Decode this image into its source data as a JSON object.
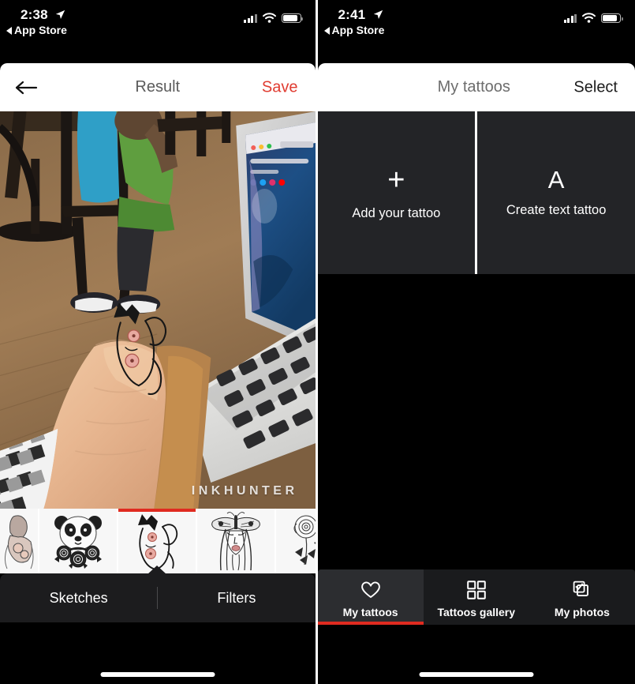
{
  "left_screen": {
    "status_bar": {
      "time": "2:38",
      "back_label": "App Store",
      "location_icon": "location-arrow-icon",
      "signal_icon": "cellular-signal-icon",
      "wifi_icon": "wifi-icon",
      "battery_icon": "battery-icon"
    },
    "nav": {
      "back_icon": "arrow-left-icon",
      "title": "Result",
      "action_label": "Save",
      "action_color": "#e03c31"
    },
    "photo": {
      "watermark": "INKHUNTER",
      "alt": "hand with fox tattoo preview in front of laptop"
    },
    "sketch_strip": {
      "selected_index": 2,
      "thumbs": [
        {
          "name": "mermaid-sketch"
        },
        {
          "name": "panda-roses-sketch"
        },
        {
          "name": "fox-flower-sketch"
        },
        {
          "name": "moth-woman-sketch"
        },
        {
          "name": "rose-sketch"
        }
      ]
    },
    "bottom_tabs": [
      {
        "label": "Sketches",
        "active": true
      },
      {
        "label": "Filters",
        "active": false
      }
    ]
  },
  "right_screen": {
    "status_bar": {
      "time": "2:41",
      "back_label": "App Store",
      "location_icon": "location-arrow-icon",
      "signal_icon": "cellular-signal-icon",
      "wifi_icon": "wifi-icon",
      "battery_icon": "battery-icon"
    },
    "nav": {
      "title": "My tattoos",
      "action_label": "Select",
      "action_color": "#1c1c1c"
    },
    "tiles": [
      {
        "glyph": "+",
        "icon": "plus-icon",
        "label": "Add your tattoo"
      },
      {
        "glyph": "A",
        "icon": "text-letter-icon",
        "label": "Create text tattoo"
      }
    ],
    "tab_bar": {
      "accent_color": "#e02b20",
      "tabs": [
        {
          "label": "My tattoos",
          "icon": "heart-icon",
          "active": true
        },
        {
          "label": "Tattoos gallery",
          "icon": "grid-icon",
          "active": false
        },
        {
          "label": "My photos",
          "icon": "photos-check-icon",
          "active": false
        }
      ]
    }
  }
}
